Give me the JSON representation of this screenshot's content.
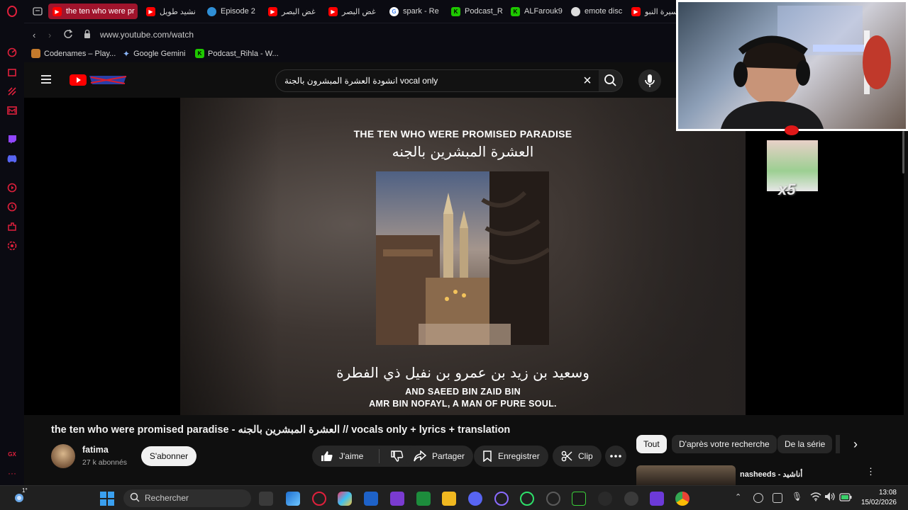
{
  "browser": {
    "tabs": [
      {
        "title": "the ten who were pr",
        "favicon": "youtube-icon",
        "active": true
      },
      {
        "title": "نشيد طويل",
        "favicon": "youtube-icon"
      },
      {
        "title": "Episode 2",
        "favicon": "edge-icon"
      },
      {
        "title": "غض البصر",
        "favicon": "youtube-icon"
      },
      {
        "title": "غض البصر",
        "favicon": "youtube-icon"
      },
      {
        "title": "spark - Re",
        "favicon": "google-icon"
      },
      {
        "title": "Podcast_R",
        "favicon": "green-k-icon"
      },
      {
        "title": "ALFarouk9",
        "favicon": "green-k-icon"
      },
      {
        "title": "emote disc",
        "favicon": "emote-icon"
      },
      {
        "title": "السيرة النبو",
        "favicon": "youtube-icon"
      }
    ],
    "url": "www.youtube.com/watch",
    "bookmarks": [
      {
        "label": "Codenames – Play...",
        "icon": "codenames-icon"
      },
      {
        "label": "Google Gemini",
        "icon": "gemini-icon"
      },
      {
        "label": "Podcast_Rihla - W...",
        "icon": "green-k-icon"
      }
    ]
  },
  "youtube": {
    "search_query": "انشودة العشرة المبشرون بالجنة vocal only",
    "video": {
      "overlay_title_en": "THE TEN WHO WERE PROMISED PARADISE",
      "overlay_title_ar": "العشرة المبشرين بالجنه",
      "subtitle_ar": "وسعيد بن زيد بن عمرو بن نفيل ذي الفطرة",
      "subtitle_en_line1": "AND SAEED BIN ZAID BIN",
      "subtitle_en_line2": "AMR BIN NOFAYL, A MAN OF PURE SOUL."
    },
    "title": "the ten who were promised paradise - العشرة المبشرين بالجنه // vocals only + lyrics + translation",
    "channel": {
      "name": "fatima",
      "subscribers": "27 k abonnés",
      "subscribe_label": "S'abonner"
    },
    "actions": {
      "like": "J'aime",
      "share": "Partager",
      "save": "Enregistrer",
      "clip": "Clip"
    },
    "chips": [
      "Tout",
      "D'après votre recherche",
      "De la série"
    ],
    "related_preview_title": "nasheeds - أناشيد"
  },
  "overlay": {
    "badge": "x5"
  },
  "taskbar": {
    "weather": "1°",
    "search_placeholder": "Rechercher",
    "time": "13:08",
    "date": "15/02/2026",
    "sidebar_badge": "GX"
  }
}
